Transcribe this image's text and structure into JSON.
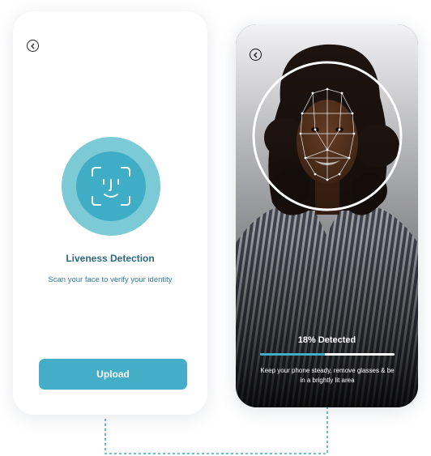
{
  "left_screen": {
    "title": "Liveness Detection",
    "subtitle": "Scan your face to verify your identity",
    "upload_label": "Upload",
    "icons": [
      "back-arrow-icon",
      "face-id-icon"
    ]
  },
  "right_screen": {
    "detected_label": "18% Detected",
    "progress": 0.48,
    "hint": "Keep your phone steady, remove glasses & be in a brightly lit area",
    "icons": [
      "back-arrow-icon",
      "face-mesh-overlay"
    ]
  },
  "colors": {
    "accent": "#44aec8",
    "accent_light": "#7bcad6",
    "title": "#2a6b82",
    "connector": "#3eadc5"
  }
}
